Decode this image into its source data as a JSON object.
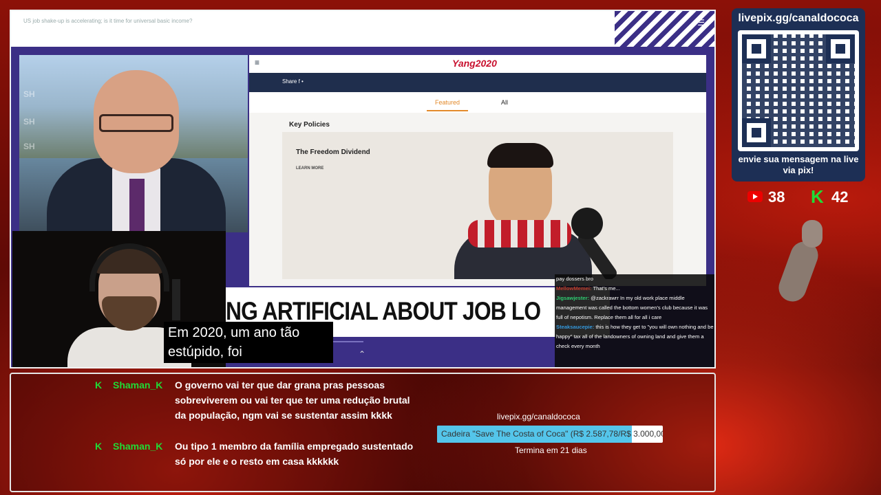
{
  "video": {
    "title": "US job shake-up is accelerating; is it time for universal basic income?",
    "site": {
      "logo": "Yang2020",
      "share_label": "Share  f  •",
      "tabs": [
        "Featured",
        "All"
      ],
      "section_title": "Key Policies",
      "card_title": "The Freedom Dividend",
      "card_link": "LEARN MORE"
    },
    "headline": "NG ARTIFICIAL ABOUT JOB LO",
    "subtitle": "Em 2020, um ano tão estúpido, foi"
  },
  "stream_chat": [
    {
      "user": "",
      "text": "pay dossers bro"
    },
    {
      "user": "MellowMemei:",
      "text": "That's me..."
    },
    {
      "user": "Jigsawjester:",
      "text": "@zackrawrr In my old work place middle management was called the                bottom women's club because it was full of nepotism. Replace them all for all i care"
    },
    {
      "user": "Steaksaucepie:",
      "text": "this is how they get to \"you will own nothing and be happy\" tax all of the landowners      of owning land and give them a check every month"
    }
  ],
  "chat_messages": [
    {
      "user": "Shaman_K",
      "text": "O governo vai ter que dar grana pras pessoas sobreviverem ou vai ter que ter uma redução brutal da população, ngm vai se sustentar assim kkkk"
    },
    {
      "user": "Shaman_K",
      "text": "Ou tipo 1 membro da família empregado sustentado só por ele e o resto em casa kkkkkk"
    }
  ],
  "goal": {
    "url": "livepix.gg/canaldococa",
    "label": "Cadeira \"Save The Costa of Coca\" (R$ 2.587,78/R$ 3.000,00)",
    "progress": 0.8626,
    "ends": "Termina em 21 dias"
  },
  "pix": {
    "url": "livepix.gg/canaldococa",
    "cta": "envie sua mensagem na live via pix!"
  },
  "viewers": {
    "youtube": "38",
    "kick": "42"
  },
  "colors": {
    "kick_green": "#1fdc36",
    "youtube_red": "#ee0000",
    "pix_panel": "#1d2f55",
    "goal_fill": "#54c5ea"
  }
}
